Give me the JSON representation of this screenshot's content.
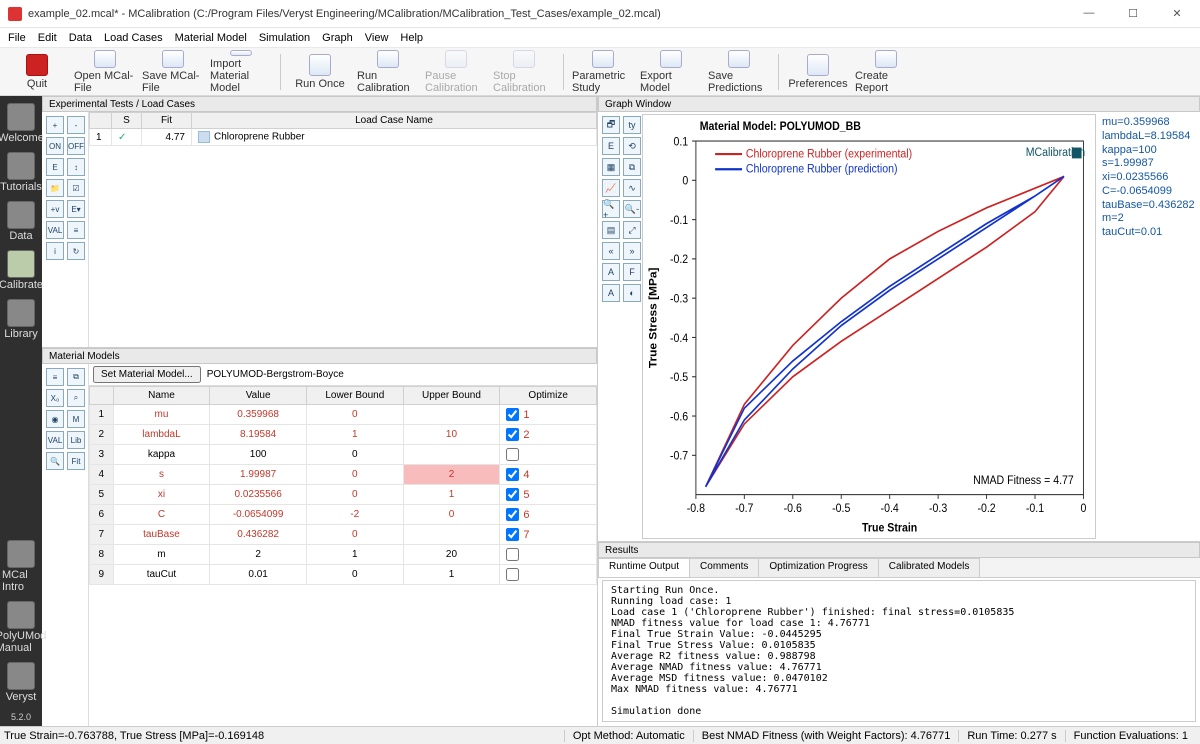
{
  "window": {
    "title": "example_02.mcal* - MCalibration (C:/Program Files/Veryst Engineering/MCalibration/MCalibration_Test_Cases/example_02.mcal)"
  },
  "menu": [
    "File",
    "Edit",
    "Data",
    "Load Cases",
    "Material Model",
    "Simulation",
    "Graph",
    "View",
    "Help"
  ],
  "toolbar": [
    {
      "label": "Quit",
      "klass": "quit"
    },
    {
      "label": "Open MCal-File"
    },
    {
      "label": "Save MCal-File"
    },
    {
      "label": "Import Material Model"
    },
    {
      "sep": true
    },
    {
      "label": "Run Once"
    },
    {
      "label": "Run Calibration"
    },
    {
      "label": "Pause Calibration",
      "disabled": true
    },
    {
      "label": "Stop Calibration",
      "disabled": true
    },
    {
      "sep": true
    },
    {
      "label": "Parametric Study"
    },
    {
      "label": "Export Model"
    },
    {
      "label": "Save Predictions"
    },
    {
      "sep": true
    },
    {
      "label": "Preferences"
    },
    {
      "label": "Create Report"
    }
  ],
  "leftnav": [
    {
      "label": "Welcome"
    },
    {
      "label": "Tutorials"
    },
    {
      "label": "Data"
    },
    {
      "label": "Calibrate",
      "sel": true
    },
    {
      "label": "Library"
    }
  ],
  "nav_bottom": [
    {
      "label": "MCal Intro"
    },
    {
      "label": "PolyUMod Manual"
    },
    {
      "label": "Veryst"
    }
  ],
  "version": "5.2.0",
  "loadcases": {
    "title": "Experimental Tests / Load Cases",
    "headers": {
      "s": "S",
      "fit": "Fit",
      "name": "Load Case Name"
    },
    "rows": [
      {
        "idx": "1",
        "s": "✓",
        "fit": "4.77",
        "name": "Chloroprene Rubber"
      }
    ],
    "iconlabels": [
      "+",
      "-",
      "ON",
      "OFF",
      "E",
      "↕",
      "📁",
      "☑",
      "+v",
      "E▾",
      "VAL",
      "≡",
      "i",
      "↻"
    ]
  },
  "matmodel": {
    "title": "Material Models",
    "set_btn": "Set Material Model...",
    "name": "POLYUMOD-Bergstrom-Boyce",
    "headers": {
      "name": "Name",
      "value": "Value",
      "lb": "Lower Bound",
      "ub": "Upper Bound",
      "opt": "Optimize"
    },
    "rows": [
      {
        "idx": "1",
        "name": "mu",
        "value": "0.359968",
        "lb": "0",
        "ub": "",
        "opt": true,
        "optn": "1",
        "red": true
      },
      {
        "idx": "2",
        "name": "lambdaL",
        "value": "8.19584",
        "lb": "1",
        "ub": "10",
        "opt": true,
        "optn": "2",
        "red": true
      },
      {
        "idx": "3",
        "name": "kappa",
        "value": "100",
        "lb": "0",
        "ub": "",
        "opt": false,
        "optn": ""
      },
      {
        "idx": "4",
        "name": "s",
        "value": "1.99987",
        "lb": "0",
        "ub": "2",
        "opt": true,
        "optn": "4",
        "red": true,
        "pinkub": true
      },
      {
        "idx": "5",
        "name": "xi",
        "value": "0.0235566",
        "lb": "0",
        "ub": "1",
        "opt": true,
        "optn": "5",
        "red": true
      },
      {
        "idx": "6",
        "name": "C",
        "value": "-0.0654099",
        "lb": "-2",
        "ub": "0",
        "opt": true,
        "optn": "6",
        "red": true
      },
      {
        "idx": "7",
        "name": "tauBase",
        "value": "0.436282",
        "lb": "0",
        "ub": "",
        "opt": true,
        "optn": "7",
        "red": true
      },
      {
        "idx": "8",
        "name": "m",
        "value": "2",
        "lb": "1",
        "ub": "20",
        "opt": false,
        "optn": ""
      },
      {
        "idx": "9",
        "name": "tauCut",
        "value": "0.01",
        "lb": "0",
        "ub": "1",
        "opt": false,
        "optn": ""
      }
    ],
    "iconlabels": [
      "≡",
      "⧉",
      "X₀",
      "⌕",
      "◉",
      "M",
      "VAL",
      "Lib",
      "🔍",
      "Fit"
    ]
  },
  "graph": {
    "title": "Graph Window",
    "iconlabels": [
      "🗗",
      "ty",
      "E",
      "⟲",
      "▦",
      "⧉",
      "📈",
      "∿",
      "🔍+",
      "🔍-",
      "▤",
      "⤢",
      "«",
      "»",
      "A",
      "F",
      "A",
      "◐"
    ],
    "chart_title": "Material Model: POLYUMOD_BB",
    "legend": [
      "Chloroprene Rubber (experimental)",
      "Chloroprene Rubber (prediction)"
    ],
    "xlabel": "True Strain",
    "ylabel": "True Stress [MPa]",
    "fitness": "NMAD Fitness = 4.77",
    "brand": "MCalibration"
  },
  "params": [
    "mu=0.359968",
    "lambdaL=8.19584",
    "kappa=100",
    "s=1.99987",
    "xi=0.0235566",
    "C=-0.0654099",
    "tauBase=0.436282",
    "m=2",
    "tauCut=0.01"
  ],
  "results": {
    "title": "Results",
    "tabs": [
      "Runtime Output",
      "Comments",
      "Optimization Progress",
      "Calibrated Models"
    ],
    "output": "Starting Run Once.\nRunning load case: 1\nLoad case 1 ('Chloroprene Rubber') finished: final stress=0.0105835\nNMAD fitness value for load case 1: 4.76771\nFinal True Strain Value: -0.0445295\nFinal True Stress Value: 0.0105835\nAverage R2 fitness value: 0.988798\nAverage NMAD fitness value: 4.76771\nAverage MSD fitness value: 0.0470102\nMax NMAD fitness value: 4.76771\n\nSimulation done"
  },
  "status": {
    "left": "True Strain=-0.763788, True Stress [MPa]=-0.169148",
    "cells": [
      "Opt Method: Automatic",
      "Best NMAD Fitness (with Weight Factors): 4.76771",
      "Run Time: 0.277 s",
      "Function Evaluations: 1"
    ]
  },
  "chart_data": {
    "type": "line",
    "xlabel": "True Strain",
    "ylabel": "True Stress [MPa]",
    "xlim": [
      -0.8,
      0
    ],
    "ylim": [
      -0.8,
      0.1
    ],
    "xticks": [
      -0.8,
      -0.7,
      -0.6,
      -0.5,
      -0.4,
      -0.3,
      -0.2,
      -0.1,
      0
    ],
    "yticks": [
      -0.7,
      -0.6,
      -0.5,
      -0.4,
      -0.3,
      -0.2,
      -0.1,
      0,
      0.1
    ],
    "series": [
      {
        "name": "Chloroprene Rubber (experimental)",
        "color": "#cc2222",
        "x": [
          -0.04,
          -0.1,
          -0.2,
          -0.3,
          -0.4,
          -0.5,
          -0.6,
          -0.7,
          -0.78,
          -0.7,
          -0.6,
          -0.5,
          -0.4,
          -0.3,
          -0.2,
          -0.1,
          -0.04
        ],
        "y": [
          0.01,
          -0.02,
          -0.07,
          -0.13,
          -0.2,
          -0.3,
          -0.42,
          -0.57,
          -0.78,
          -0.62,
          -0.5,
          -0.41,
          -0.33,
          -0.25,
          -0.17,
          -0.08,
          0.01
        ]
      },
      {
        "name": "Chloroprene Rubber (prediction)",
        "color": "#1133cc",
        "x": [
          -0.04,
          -0.1,
          -0.2,
          -0.3,
          -0.4,
          -0.5,
          -0.6,
          -0.7,
          -0.78,
          -0.7,
          -0.6,
          -0.5,
          -0.4,
          -0.3,
          -0.2,
          -0.1,
          -0.04
        ],
        "y": [
          0.01,
          -0.04,
          -0.12,
          -0.2,
          -0.28,
          -0.37,
          -0.48,
          -0.61,
          -0.78,
          -0.58,
          -0.46,
          -0.36,
          -0.27,
          -0.19,
          -0.11,
          -0.04,
          0.01
        ]
      }
    ]
  }
}
